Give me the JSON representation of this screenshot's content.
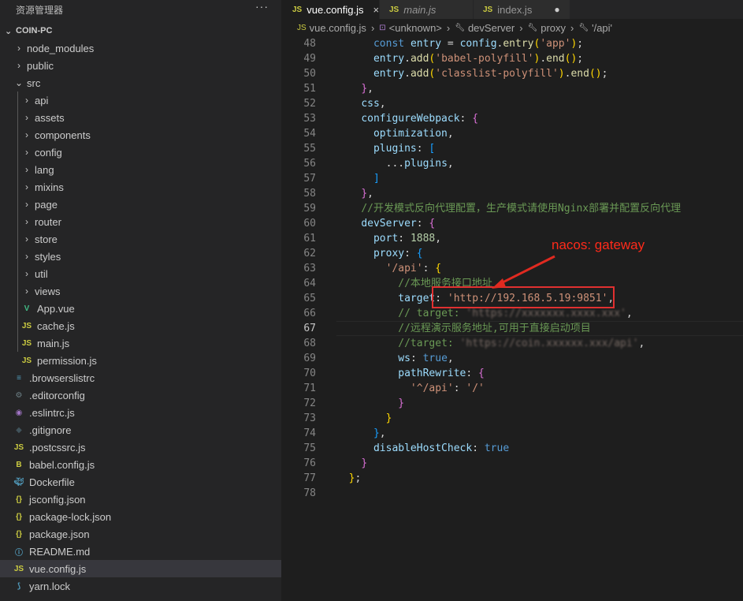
{
  "sidebar": {
    "title": "资源管理器",
    "more": "···",
    "project": "COIN-PC",
    "items": [
      {
        "label": "node_modules",
        "type": "folder",
        "depth": 1,
        "expanded": false
      },
      {
        "label": "public",
        "type": "folder",
        "depth": 1,
        "expanded": false
      },
      {
        "label": "src",
        "type": "folder",
        "depth": 1,
        "expanded": true
      },
      {
        "label": "api",
        "type": "folder",
        "depth": 2,
        "expanded": false
      },
      {
        "label": "assets",
        "type": "folder",
        "depth": 2,
        "expanded": false
      },
      {
        "label": "components",
        "type": "folder",
        "depth": 2,
        "expanded": false
      },
      {
        "label": "config",
        "type": "folder",
        "depth": 2,
        "expanded": false
      },
      {
        "label": "lang",
        "type": "folder",
        "depth": 2,
        "expanded": false
      },
      {
        "label": "mixins",
        "type": "folder",
        "depth": 2,
        "expanded": false
      },
      {
        "label": "page",
        "type": "folder",
        "depth": 2,
        "expanded": false
      },
      {
        "label": "router",
        "type": "folder",
        "depth": 2,
        "expanded": false
      },
      {
        "label": "store",
        "type": "folder",
        "depth": 2,
        "expanded": false
      },
      {
        "label": "styles",
        "type": "folder",
        "depth": 2,
        "expanded": false
      },
      {
        "label": "util",
        "type": "folder",
        "depth": 2,
        "expanded": false
      },
      {
        "label": "views",
        "type": "folder",
        "depth": 2,
        "expanded": false
      },
      {
        "label": "App.vue",
        "type": "file",
        "icon": "vue",
        "depth": 2
      },
      {
        "label": "cache.js",
        "type": "file",
        "icon": "js",
        "depth": 2
      },
      {
        "label": "main.js",
        "type": "file",
        "icon": "js",
        "depth": 2
      },
      {
        "label": "permission.js",
        "type": "file",
        "icon": "js",
        "depth": 2
      },
      {
        "label": ".browserslistrc",
        "type": "file",
        "icon": "list",
        "depth": 1
      },
      {
        "label": ".editorconfig",
        "type": "file",
        "icon": "gear",
        "depth": 1
      },
      {
        "label": ".eslintrc.js",
        "type": "file",
        "icon": "eslint",
        "depth": 1
      },
      {
        "label": ".gitignore",
        "type": "file",
        "icon": "git",
        "depth": 1
      },
      {
        "label": ".postcssrc.js",
        "type": "file",
        "icon": "js",
        "depth": 1
      },
      {
        "label": "babel.config.js",
        "type": "file",
        "icon": "babel",
        "depth": 1
      },
      {
        "label": "Dockerfile",
        "type": "file",
        "icon": "docker",
        "depth": 1
      },
      {
        "label": "jsconfig.json",
        "type": "file",
        "icon": "json",
        "depth": 1
      },
      {
        "label": "package-lock.json",
        "type": "file",
        "icon": "json",
        "depth": 1
      },
      {
        "label": "package.json",
        "type": "file",
        "icon": "json",
        "depth": 1
      },
      {
        "label": "README.md",
        "type": "file",
        "icon": "info",
        "depth": 1
      },
      {
        "label": "vue.config.js",
        "type": "file",
        "icon": "js",
        "depth": 1,
        "selected": true
      },
      {
        "label": "yarn.lock",
        "type": "file",
        "icon": "yarn",
        "depth": 1
      }
    ]
  },
  "tabs": [
    {
      "label": "vue.config.js",
      "icon": "JS",
      "active": true,
      "close": "×"
    },
    {
      "label": "main.js",
      "icon": "JS",
      "active": false,
      "italic": true
    },
    {
      "label": "index.js",
      "icon": "JS",
      "active": false,
      "dirty": "●"
    }
  ],
  "breadcrumb": [
    "vue.config.js",
    "<unknown>",
    "devServer",
    "proxy",
    "'/api'"
  ],
  "breadcrumb_icon": "JS",
  "annotation": {
    "label": "nacos: gateway",
    "color": "#ff2a1a"
  },
  "current_line": 67,
  "code_lines": [
    {
      "n": 48,
      "t": [
        [
          "",
          "      "
        ],
        [
          "k",
          "const "
        ],
        [
          "prop",
          "entry"
        ],
        [
          "pu",
          " = "
        ],
        [
          "prop",
          "config"
        ],
        [
          "pu",
          "."
        ],
        [
          "fn",
          "entry"
        ],
        [
          "br1",
          "("
        ],
        [
          "str",
          "'app'"
        ],
        [
          "br1",
          ")"
        ],
        [
          "pu",
          ";"
        ]
      ]
    },
    {
      "n": 49,
      "t": [
        [
          "",
          "      "
        ],
        [
          "prop",
          "entry"
        ],
        [
          "pu",
          "."
        ],
        [
          "fn",
          "add"
        ],
        [
          "br1",
          "("
        ],
        [
          "str",
          "'babel-polyfill'"
        ],
        [
          "br1",
          ")"
        ],
        [
          "pu",
          "."
        ],
        [
          "fn",
          "end"
        ],
        [
          "br1",
          "()"
        ],
        [
          "pu",
          ";"
        ]
      ]
    },
    {
      "n": 50,
      "t": [
        [
          "",
          "      "
        ],
        [
          "prop",
          "entry"
        ],
        [
          "pu",
          "."
        ],
        [
          "fn",
          "add"
        ],
        [
          "br1",
          "("
        ],
        [
          "str",
          "'classlist-polyfill'"
        ],
        [
          "br1",
          ")"
        ],
        [
          "pu",
          "."
        ],
        [
          "fn",
          "end"
        ],
        [
          "br1",
          "()"
        ],
        [
          "pu",
          ";"
        ]
      ]
    },
    {
      "n": 51,
      "t": [
        [
          "",
          "    "
        ],
        [
          "br2",
          "}"
        ],
        [
          "pu",
          ","
        ]
      ]
    },
    {
      "n": 52,
      "t": [
        [
          "",
          "    "
        ],
        [
          "prop",
          "css"
        ],
        [
          "pu",
          ","
        ]
      ]
    },
    {
      "n": 53,
      "t": [
        [
          "",
          "    "
        ],
        [
          "prop",
          "configureWebpack"
        ],
        [
          "pu",
          ": "
        ],
        [
          "br2",
          "{"
        ]
      ]
    },
    {
      "n": 54,
      "t": [
        [
          "",
          "      "
        ],
        [
          "prop",
          "optimization"
        ],
        [
          "pu",
          ","
        ]
      ]
    },
    {
      "n": 55,
      "t": [
        [
          "",
          "      "
        ],
        [
          "prop",
          "plugins"
        ],
        [
          "pu",
          ": "
        ],
        [
          "br3",
          "["
        ]
      ]
    },
    {
      "n": 56,
      "t": [
        [
          "",
          "        "
        ],
        [
          "pu",
          "..."
        ],
        [
          "prop",
          "plugins"
        ],
        [
          "pu",
          ","
        ]
      ]
    },
    {
      "n": 57,
      "t": [
        [
          "",
          "      "
        ],
        [
          "br3",
          "]"
        ]
      ]
    },
    {
      "n": 58,
      "t": [
        [
          "",
          "    "
        ],
        [
          "br2",
          "}"
        ],
        [
          "pu",
          ","
        ]
      ]
    },
    {
      "n": 59,
      "t": [
        [
          "",
          "    "
        ],
        [
          "cm",
          "//开发模式反向代理配置，生产模式请使用Nginx部署并配置反向代理"
        ]
      ]
    },
    {
      "n": 60,
      "t": [
        [
          "",
          "    "
        ],
        [
          "prop",
          "devServer"
        ],
        [
          "pu",
          ": "
        ],
        [
          "br2",
          "{"
        ]
      ]
    },
    {
      "n": 61,
      "t": [
        [
          "",
          "      "
        ],
        [
          "prop",
          "port"
        ],
        [
          "pu",
          ": "
        ],
        [
          "num",
          "1888"
        ],
        [
          "pu",
          ","
        ]
      ]
    },
    {
      "n": 62,
      "t": [
        [
          "",
          "      "
        ],
        [
          "prop",
          "proxy"
        ],
        [
          "pu",
          ": "
        ],
        [
          "br3",
          "{"
        ]
      ]
    },
    {
      "n": 63,
      "t": [
        [
          "",
          "        "
        ],
        [
          "str",
          "'/api'"
        ],
        [
          "pu",
          ": "
        ],
        [
          "br1",
          "{"
        ]
      ]
    },
    {
      "n": 64,
      "t": [
        [
          "",
          "          "
        ],
        [
          "cm",
          "//本地服务接口地址"
        ]
      ]
    },
    {
      "n": 65,
      "t": [
        [
          "",
          "          "
        ],
        [
          "prop",
          "target"
        ],
        [
          "pu",
          ": "
        ],
        [
          "str",
          "'http://192.168.5.19:9851'"
        ],
        [
          "pu",
          ","
        ]
      ]
    },
    {
      "n": 66,
      "t": [
        [
          "",
          "          "
        ],
        [
          "cm",
          "// target: "
        ],
        [
          "blur",
          "'https://xxxxxxx.xxxx.xxx'"
        ],
        [
          "pu",
          ","
        ]
      ]
    },
    {
      "n": 67,
      "t": [
        [
          "",
          "          "
        ],
        [
          "cm",
          "//远程演示服务地址,可用于直接启动项目"
        ]
      ]
    },
    {
      "n": 68,
      "t": [
        [
          "",
          "          "
        ],
        [
          "cm",
          "//target: "
        ],
        [
          "blur",
          "'https://coin.xxxxxx.xxx/api'"
        ],
        [
          "pu",
          ","
        ]
      ]
    },
    {
      "n": 69,
      "t": [
        [
          "",
          "          "
        ],
        [
          "prop",
          "ws"
        ],
        [
          "pu",
          ": "
        ],
        [
          "k",
          "true"
        ],
        [
          "pu",
          ","
        ]
      ]
    },
    {
      "n": 70,
      "t": [
        [
          "",
          "          "
        ],
        [
          "prop",
          "pathRewrite"
        ],
        [
          "pu",
          ": "
        ],
        [
          "br2",
          "{"
        ]
      ]
    },
    {
      "n": 71,
      "t": [
        [
          "",
          "            "
        ],
        [
          "str",
          "'^/api'"
        ],
        [
          "pu",
          ": "
        ],
        [
          "str",
          "'/'"
        ]
      ]
    },
    {
      "n": 72,
      "t": [
        [
          "",
          "          "
        ],
        [
          "br2",
          "}"
        ]
      ]
    },
    {
      "n": 73,
      "t": [
        [
          "",
          "        "
        ],
        [
          "br1",
          "}"
        ]
      ]
    },
    {
      "n": 74,
      "t": [
        [
          "",
          "      "
        ],
        [
          "br3",
          "}"
        ],
        [
          "pu",
          ","
        ]
      ]
    },
    {
      "n": 75,
      "t": [
        [
          "",
          "      "
        ],
        [
          "prop",
          "disableHostCheck"
        ],
        [
          "pu",
          ": "
        ],
        [
          "k",
          "true"
        ]
      ]
    },
    {
      "n": 76,
      "t": [
        [
          "",
          "    "
        ],
        [
          "br2",
          "}"
        ]
      ]
    },
    {
      "n": 77,
      "t": [
        [
          "",
          "  "
        ],
        [
          "br1",
          "}"
        ],
        [
          "pu",
          ";"
        ]
      ]
    },
    {
      "n": 78,
      "t": []
    }
  ]
}
